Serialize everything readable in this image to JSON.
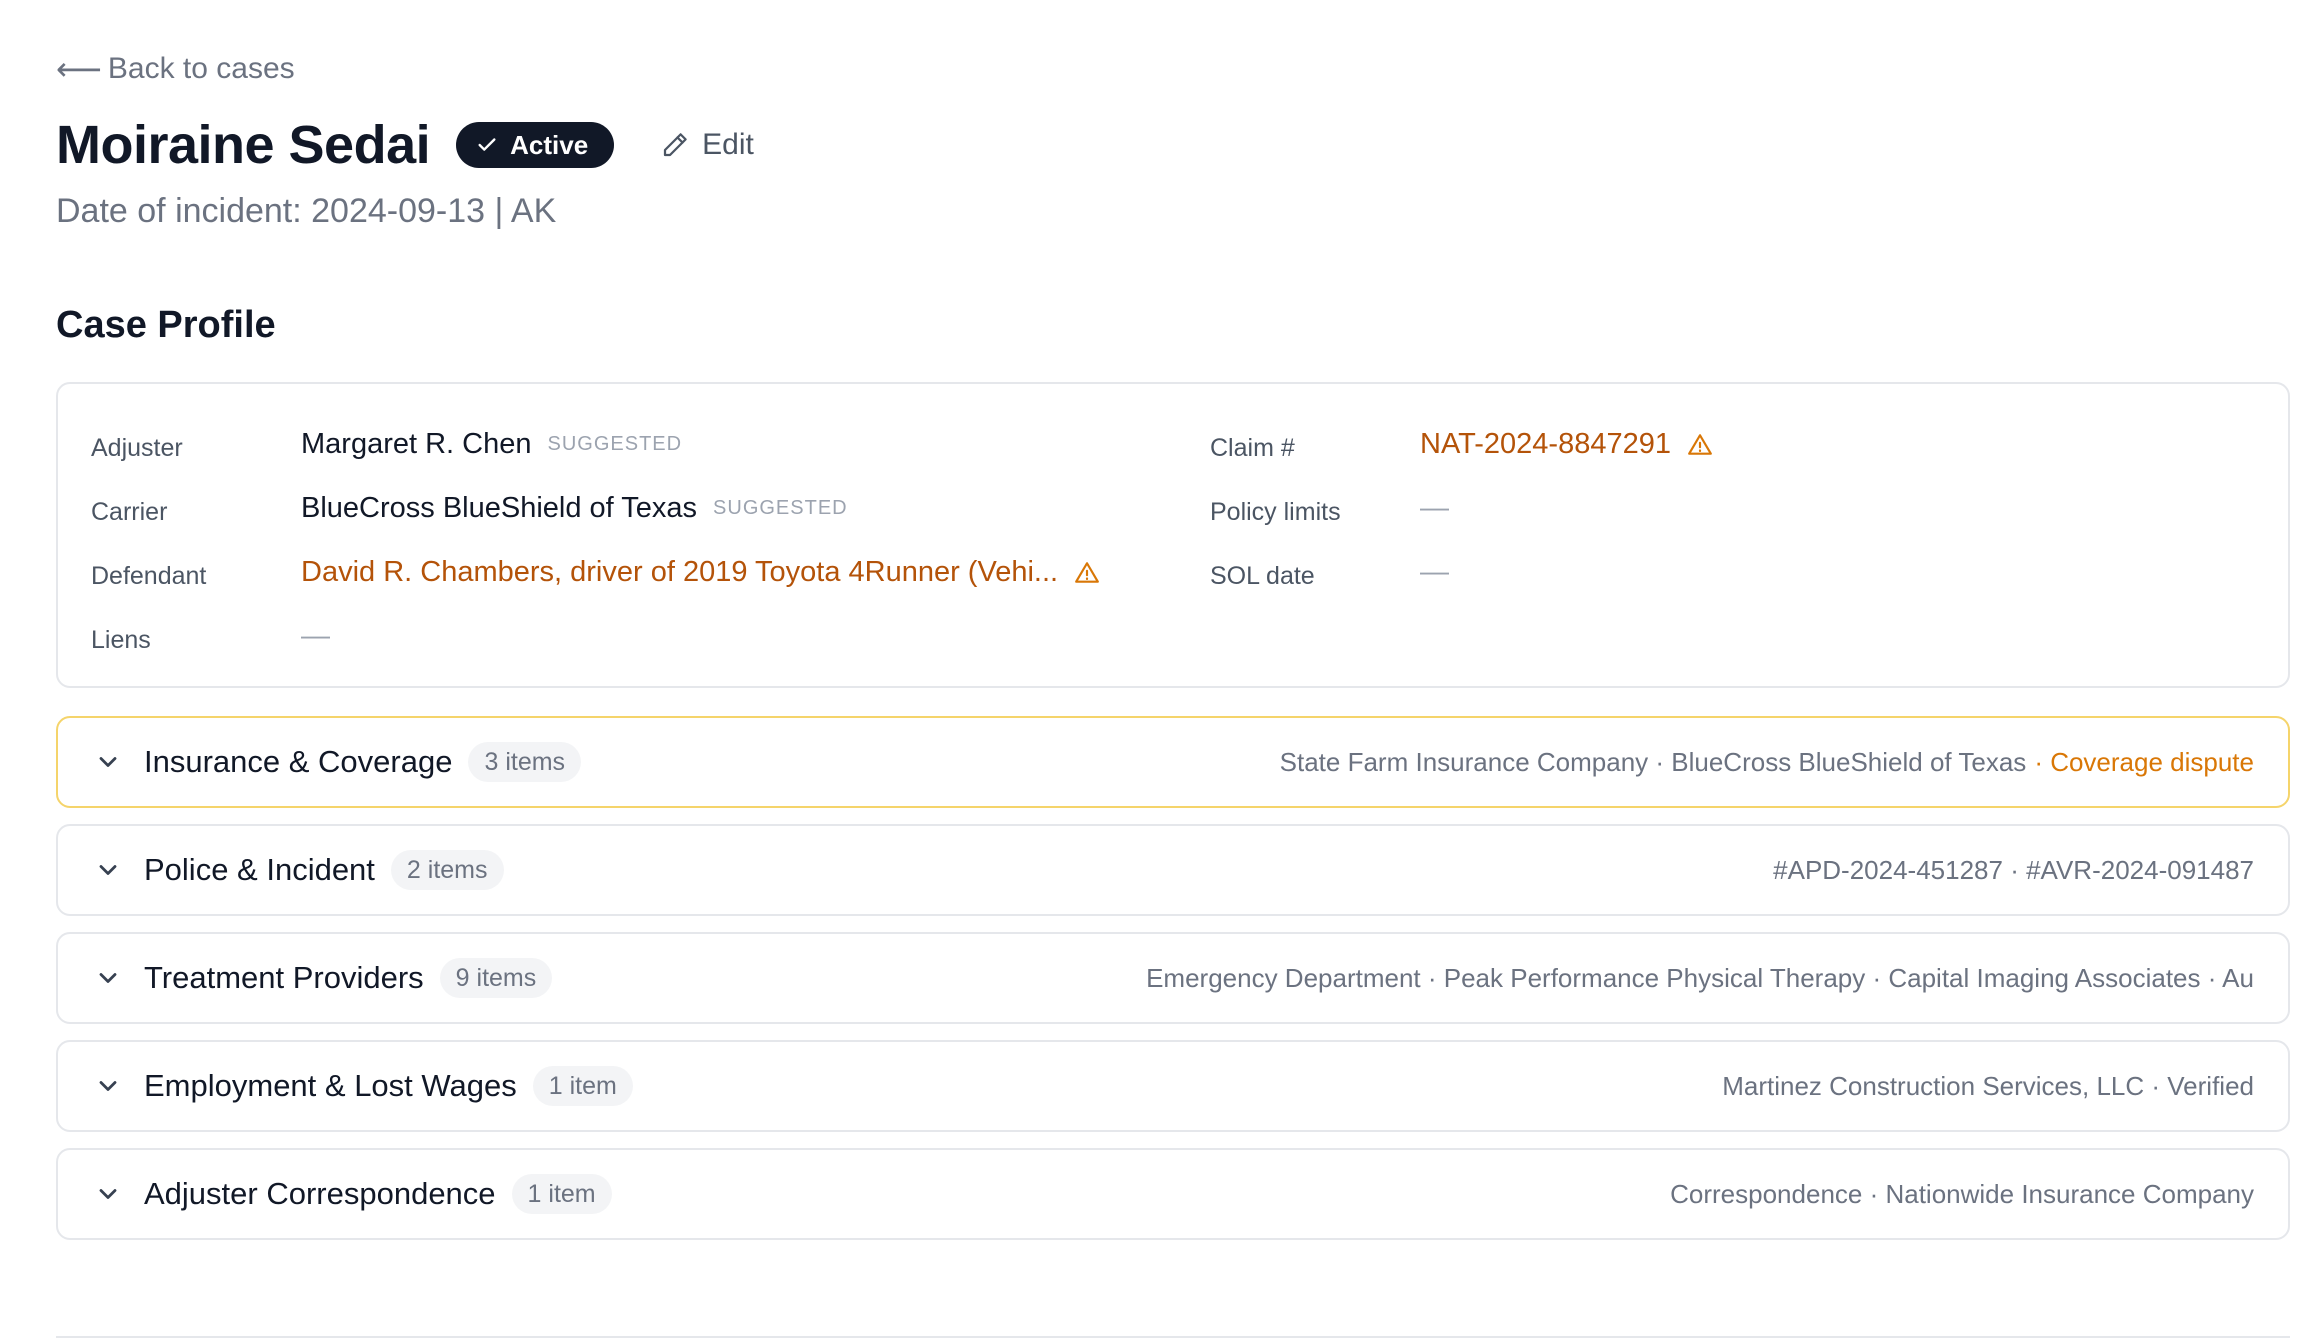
{
  "nav": {
    "back_label": "Back to cases"
  },
  "header": {
    "title": "Moiraine Sedai",
    "status": "Active",
    "edit_label": "Edit",
    "subtitle": "Date of incident: 2024-09-13 | AK"
  },
  "profile": {
    "section_title": "Case Profile",
    "adjuster": {
      "label": "Adjuster",
      "value": "Margaret R. Chen",
      "tag": "SUGGESTED"
    },
    "carrier": {
      "label": "Carrier",
      "value": "BlueCross BlueShield of Texas",
      "tag": "SUGGESTED"
    },
    "defendant": {
      "label": "Defendant",
      "value": "David R. Chambers, driver of 2019 Toyota 4Runner (Vehi..."
    },
    "liens": {
      "label": "Liens",
      "value": "—"
    },
    "claim": {
      "label": "Claim #",
      "value": "NAT-2024-8847291"
    },
    "policy_limits": {
      "label": "Policy limits",
      "value": "—"
    },
    "sol_date": {
      "label": "SOL date",
      "value": "—"
    }
  },
  "sections": [
    {
      "title": "Insurance & Coverage",
      "count": "3 items",
      "summary": "State Farm Insurance Company · BlueCross BlueShield of Texas",
      "alert": "· Coverage dispute"
    },
    {
      "title": "Police & Incident",
      "count": "2 items",
      "summary": "#APD-2024-451287 · #AVR-2024-091487"
    },
    {
      "title": "Treatment Providers",
      "count": "9 items",
      "summary": "Emergency Department · Peak Performance Physical Therapy · Capital Imaging Associates · Au"
    },
    {
      "title": "Employment & Lost Wages",
      "count": "1 item",
      "summary": "Martinez Construction Services, LLC · Verified"
    },
    {
      "title": "Adjuster Correspondence",
      "count": "1 item",
      "summary": "Correspondence · Nationwide Insurance Company"
    }
  ],
  "colors": {
    "warning": "#b45309",
    "alert": "#d97706",
    "highlight_border": "#f5d46b",
    "status_bg": "#111827"
  },
  "icons": [
    "arrow-left-icon",
    "check-icon",
    "pencil-icon",
    "warning-icon",
    "chevron-down-icon"
  ]
}
